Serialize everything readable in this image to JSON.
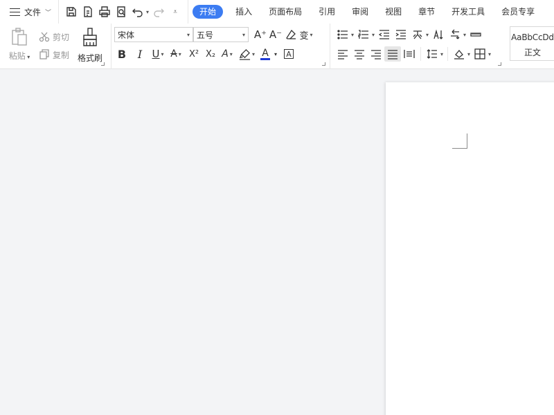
{
  "menu": {
    "file_label": "文件",
    "quick_access_icons": [
      "save-icon",
      "export-pdf-icon",
      "print-icon",
      "print-preview-icon",
      "undo-icon",
      "redo-icon",
      "customize-icon"
    ],
    "tabs": [
      {
        "label": "开始",
        "active": true
      },
      {
        "label": "插入"
      },
      {
        "label": "页面布局"
      },
      {
        "label": "引用"
      },
      {
        "label": "审阅"
      },
      {
        "label": "视图"
      },
      {
        "label": "章节"
      },
      {
        "label": "开发工具"
      },
      {
        "label": "会员专享"
      }
    ],
    "accent": "#3c7cf2"
  },
  "clipboard": {
    "paste_label": "粘贴",
    "cut_label": "剪切",
    "copy_label": "复制",
    "format_painter_label": "格式刷"
  },
  "font": {
    "family": "宋体",
    "size": "五号",
    "grow_glyph": "A⁺",
    "shrink_glyph": "A⁻",
    "bold_glyph": "B",
    "italic_glyph": "I",
    "underline_glyph": "U",
    "strike_glyph": "A",
    "superscript_glyph": "X²",
    "subscript_glyph": "X₂",
    "effect_glyph": "A",
    "color_glyph": "A",
    "border_glyph": "A",
    "phonetic_glyph": "变",
    "font_color": "#1f3bd6"
  },
  "styles": {
    "sample": "AaBbCcDd",
    "name": "正文"
  }
}
